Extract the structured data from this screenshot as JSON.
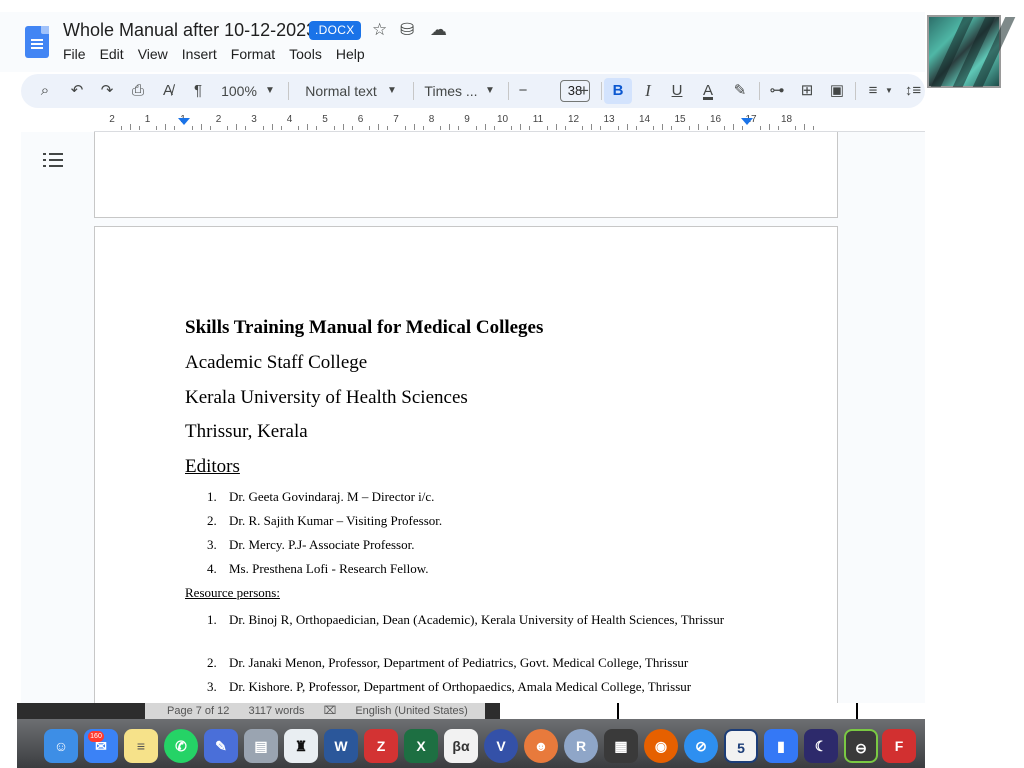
{
  "app": {
    "doc_title": "Whole Manual after 10-12-2023",
    "format_badge": ".DOCX",
    "title_icons": [
      "star-icon",
      "move-to-drive-icon",
      "cloud-status-icon"
    ]
  },
  "menu": [
    "File",
    "Edit",
    "View",
    "Insert",
    "Format",
    "Tools",
    "Help"
  ],
  "toolbar": {
    "zoom": "100%",
    "style": "Normal text",
    "font": "Times ...",
    "font_size": "38",
    "minus": "−",
    "plus": "+",
    "bold": "B",
    "italic": "I",
    "underline": "U",
    "text_color": "A"
  },
  "ruler": {
    "numbers": [
      "2",
      "1",
      "1",
      "2",
      "3",
      "4",
      "5",
      "6",
      "7",
      "8",
      "9",
      "10",
      "11",
      "12",
      "13",
      "14",
      "15",
      "16",
      "17",
      "18"
    ]
  },
  "document": {
    "title": "Skills Training Manual for Medical Colleges",
    "lines": [
      "Academic Staff College",
      "Kerala University of Health Sciences",
      "Thrissur, Kerala"
    ],
    "editors_heading": "Editors",
    "editors": [
      {
        "num": "1.",
        "text": "Dr. Geeta Govindaraj. M – Director i/c."
      },
      {
        "num": "2.",
        "text": "Dr. R. Sajith Kumar – Visiting Professor."
      },
      {
        "num": "3.",
        "text": "Dr. Mercy. P.J- Associate Professor."
      },
      {
        "num": "4.",
        "text": "Ms. Presthena Lofi - Research Fellow."
      }
    ],
    "resource_heading": "Resource persons:",
    "resource_persons": [
      {
        "num": "1.",
        "text": "Dr. Binoj R, Orthopaedician, Dean (Academic), Kerala University of Health Sciences, Thrissur"
      },
      {
        "num": "2.",
        "text": "Dr. Janaki Menon, Professor, Department of Pediatrics, Govt. Medical College, Thrissur"
      },
      {
        "num": "3.",
        "text": "Dr. Kishore. P, Professor, Department of Orthopaedics, Amala Medical College, Thrissur"
      }
    ]
  },
  "status": {
    "page": "Page 7 of 12",
    "words": "3117 words",
    "language": "English (United States)"
  },
  "dock": {
    "mail_badge": "160",
    "apps": [
      "finder",
      "mail",
      "notes",
      "whatsapp",
      "pencil",
      "scanner",
      "kindle",
      "word",
      "zotero",
      "excel",
      "mathtype",
      "vpn",
      "bartender",
      "r",
      "calculator",
      "firefox",
      "safari",
      "html5",
      "keynote",
      "night-owl",
      "toggle",
      "fontforge"
    ]
  },
  "colors": {
    "accent": "#1a73e8",
    "toolbar_bg": "#edf2fa",
    "bold_active_bg": "#d3e3fd"
  }
}
